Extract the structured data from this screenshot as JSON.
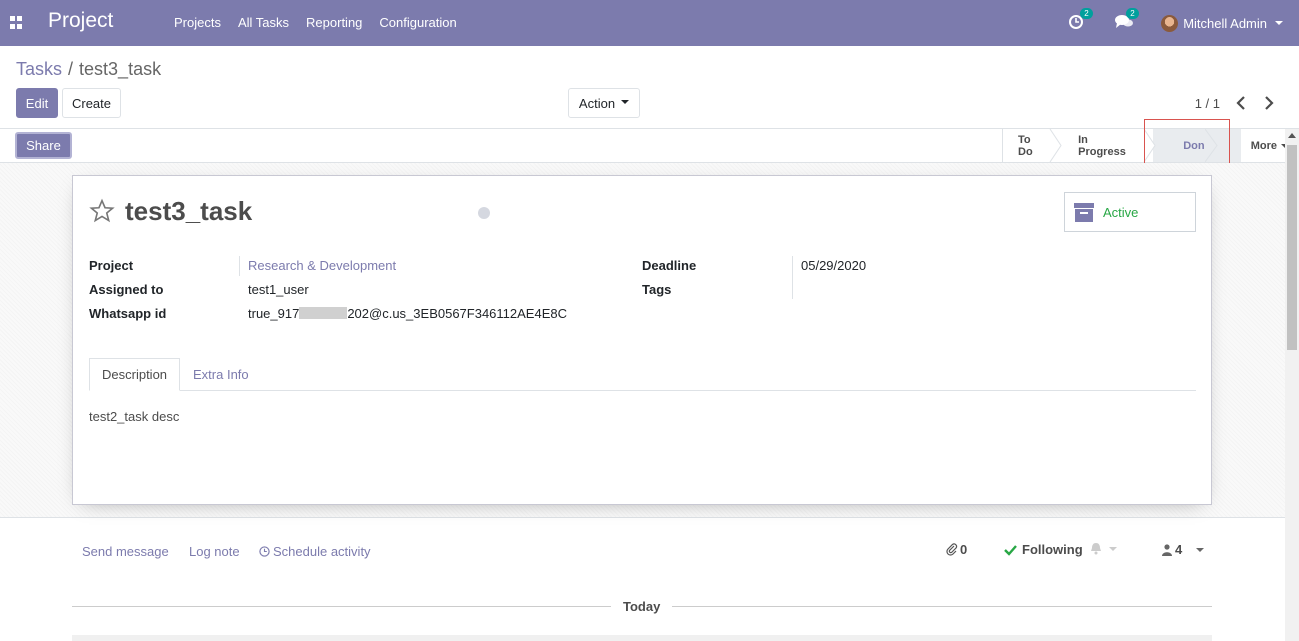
{
  "navbar": {
    "brand": "Project",
    "menu": [
      "Projects",
      "All Tasks",
      "Reporting",
      "Configuration"
    ],
    "activity_count": "2",
    "message_count": "2",
    "user_name": "Mitchell Admin"
  },
  "breadcrumb": {
    "parent": "Tasks",
    "separator": "/",
    "current": "test3_task"
  },
  "buttons": {
    "edit": "Edit",
    "create": "Create",
    "action": "Action",
    "share": "Share"
  },
  "pager": {
    "value": "1 / 1"
  },
  "stages": {
    "items": [
      "To Do",
      "In Progress",
      "Done"
    ],
    "active": "Done",
    "more": "More"
  },
  "task": {
    "name": "test3_task",
    "active_label": "Active",
    "fields": {
      "project_label": "Project",
      "project_value": "Research & Development",
      "assigned_label": "Assigned to",
      "assigned_value": "test1_user",
      "whatsapp_label": "Whatsapp id",
      "whatsapp_prefix": "true_917",
      "whatsapp_suffix": "202@c.us_3EB0567F346112AE4E8C",
      "deadline_label": "Deadline",
      "deadline_value": "05/29/2020",
      "tags_label": "Tags"
    },
    "tabs": [
      "Description",
      "Extra Info"
    ],
    "description": "test2_task desc"
  },
  "chatter": {
    "send_message": "Send message",
    "log_note": "Log note",
    "schedule_activity": "Schedule activity",
    "attachments_count": "0",
    "following": "Following",
    "followers_count": "4",
    "today": "Today"
  },
  "colors": {
    "brand": "#7c7bad",
    "success": "#28a745",
    "highlight": "#d9534f"
  }
}
